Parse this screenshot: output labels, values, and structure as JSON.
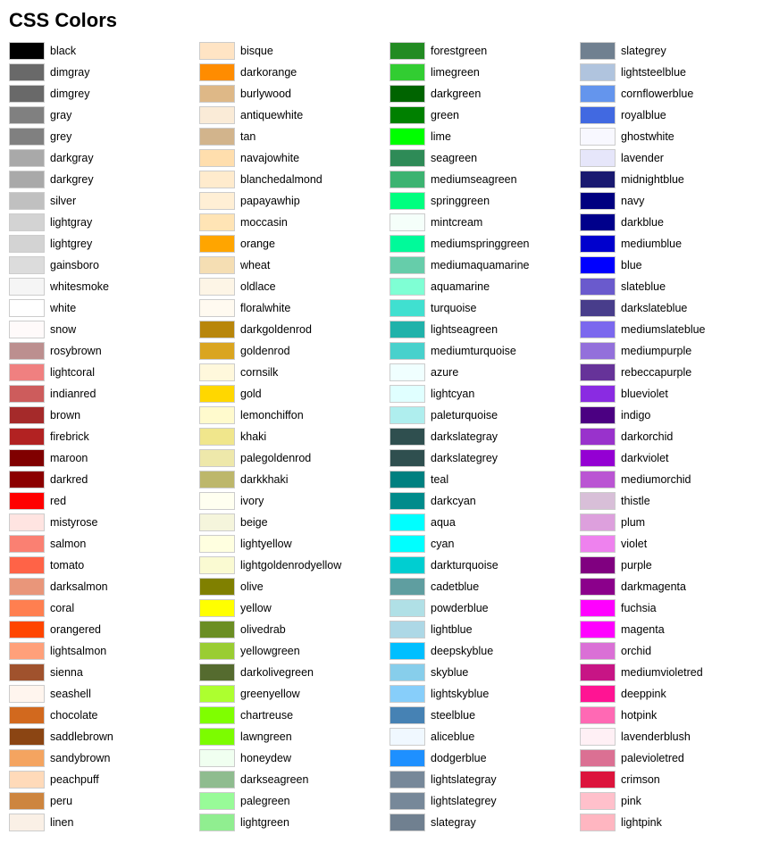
{
  "title": "CSS Colors",
  "columns": [
    [
      {
        "name": "black",
        "color": "#000000"
      },
      {
        "name": "dimgray",
        "color": "#696969"
      },
      {
        "name": "dimgrey",
        "color": "#696969"
      },
      {
        "name": "gray",
        "color": "#808080"
      },
      {
        "name": "grey",
        "color": "#808080"
      },
      {
        "name": "darkgray",
        "color": "#a9a9a9"
      },
      {
        "name": "darkgrey",
        "color": "#a9a9a9"
      },
      {
        "name": "silver",
        "color": "#c0c0c0"
      },
      {
        "name": "lightgray",
        "color": "#d3d3d3"
      },
      {
        "name": "lightgrey",
        "color": "#d3d3d3"
      },
      {
        "name": "gainsboro",
        "color": "#dcdcdc"
      },
      {
        "name": "whitesmoke",
        "color": "#f5f5f5"
      },
      {
        "name": "white",
        "color": "#ffffff"
      },
      {
        "name": "snow",
        "color": "#fffafa"
      },
      {
        "name": "rosybrown",
        "color": "#bc8f8f"
      },
      {
        "name": "lightcoral",
        "color": "#f08080"
      },
      {
        "name": "indianred",
        "color": "#cd5c5c"
      },
      {
        "name": "brown",
        "color": "#a52a2a"
      },
      {
        "name": "firebrick",
        "color": "#b22222"
      },
      {
        "name": "maroon",
        "color": "#800000"
      },
      {
        "name": "darkred",
        "color": "#8b0000"
      },
      {
        "name": "red",
        "color": "#ff0000"
      },
      {
        "name": "mistyrose",
        "color": "#ffe4e1"
      },
      {
        "name": "salmon",
        "color": "#fa8072"
      },
      {
        "name": "tomato",
        "color": "#ff6347"
      },
      {
        "name": "darksalmon",
        "color": "#e9967a"
      },
      {
        "name": "coral",
        "color": "#ff7f50"
      },
      {
        "name": "orangered",
        "color": "#ff4500"
      },
      {
        "name": "lightsalmon",
        "color": "#ffa07a"
      },
      {
        "name": "sienna",
        "color": "#a0522d"
      },
      {
        "name": "seashell",
        "color": "#fff5ee"
      },
      {
        "name": "chocolate",
        "color": "#d2691e"
      },
      {
        "name": "saddlebrown",
        "color": "#8b4513"
      },
      {
        "name": "sandybrown",
        "color": "#f4a460"
      },
      {
        "name": "peachpuff",
        "color": "#ffdab9"
      },
      {
        "name": "peru",
        "color": "#cd853f"
      },
      {
        "name": "linen",
        "color": "#faf0e6"
      }
    ],
    [
      {
        "name": "bisque",
        "color": "#ffe4c4"
      },
      {
        "name": "darkorange",
        "color": "#ff8c00"
      },
      {
        "name": "burlywood",
        "color": "#deb887"
      },
      {
        "name": "antiquewhite",
        "color": "#faebd7"
      },
      {
        "name": "tan",
        "color": "#d2b48c"
      },
      {
        "name": "navajowhite",
        "color": "#ffdead"
      },
      {
        "name": "blanchedalmond",
        "color": "#ffebcd"
      },
      {
        "name": "papayawhip",
        "color": "#ffefd5"
      },
      {
        "name": "moccasin",
        "color": "#ffe4b5"
      },
      {
        "name": "orange",
        "color": "#ffa500"
      },
      {
        "name": "wheat",
        "color": "#f5deb3"
      },
      {
        "name": "oldlace",
        "color": "#fdf5e6"
      },
      {
        "name": "floralwhite",
        "color": "#fffaf0"
      },
      {
        "name": "darkgoldenrod",
        "color": "#b8860b"
      },
      {
        "name": "goldenrod",
        "color": "#daa520"
      },
      {
        "name": "cornsilk",
        "color": "#fff8dc"
      },
      {
        "name": "gold",
        "color": "#ffd700"
      },
      {
        "name": "lemonchiffon",
        "color": "#fffacd"
      },
      {
        "name": "khaki",
        "color": "#f0e68c"
      },
      {
        "name": "palegoldenrod",
        "color": "#eee8aa"
      },
      {
        "name": "darkkhaki",
        "color": "#bdb76b"
      },
      {
        "name": "ivory",
        "color": "#fffff0"
      },
      {
        "name": "beige",
        "color": "#f5f5dc"
      },
      {
        "name": "lightyellow",
        "color": "#ffffe0"
      },
      {
        "name": "lightgoldenrodyellow",
        "color": "#fafad2"
      },
      {
        "name": "olive",
        "color": "#808000"
      },
      {
        "name": "yellow",
        "color": "#ffff00"
      },
      {
        "name": "olivedrab",
        "color": "#6b8e23"
      },
      {
        "name": "yellowgreen",
        "color": "#9acd32"
      },
      {
        "name": "darkolivegreen",
        "color": "#556b2f"
      },
      {
        "name": "greenyellow",
        "color": "#adff2f"
      },
      {
        "name": "chartreuse",
        "color": "#7fff00"
      },
      {
        "name": "lawngreen",
        "color": "#7cfc00"
      },
      {
        "name": "honeydew",
        "color": "#f0fff0"
      },
      {
        "name": "darkseagreen",
        "color": "#8fbc8f"
      },
      {
        "name": "palegreen",
        "color": "#98fb98"
      },
      {
        "name": "lightgreen",
        "color": "#90ee90"
      }
    ],
    [
      {
        "name": "forestgreen",
        "color": "#228b22"
      },
      {
        "name": "limegreen",
        "color": "#32cd32"
      },
      {
        "name": "darkgreen",
        "color": "#006400"
      },
      {
        "name": "green",
        "color": "#008000"
      },
      {
        "name": "lime",
        "color": "#00ff00"
      },
      {
        "name": "seagreen",
        "color": "#2e8b57"
      },
      {
        "name": "mediumseagreen",
        "color": "#3cb371"
      },
      {
        "name": "springgreen",
        "color": "#00ff7f"
      },
      {
        "name": "mintcream",
        "color": "#f5fffa"
      },
      {
        "name": "mediumspringgreen",
        "color": "#00fa9a"
      },
      {
        "name": "mediumaquamarine",
        "color": "#66cdaa"
      },
      {
        "name": "aquamarine",
        "color": "#7fffd4"
      },
      {
        "name": "turquoise",
        "color": "#40e0d0"
      },
      {
        "name": "lightseagreen",
        "color": "#20b2aa"
      },
      {
        "name": "mediumturquoise",
        "color": "#48d1cc"
      },
      {
        "name": "azure",
        "color": "#f0ffff"
      },
      {
        "name": "lightcyan",
        "color": "#e0ffff"
      },
      {
        "name": "paleturquoise",
        "color": "#afeeee"
      },
      {
        "name": "darkslategray",
        "color": "#2f4f4f"
      },
      {
        "name": "darkslategrey",
        "color": "#2f4f4f"
      },
      {
        "name": "teal",
        "color": "#008080"
      },
      {
        "name": "darkcyan",
        "color": "#008b8b"
      },
      {
        "name": "aqua",
        "color": "#00ffff"
      },
      {
        "name": "cyan",
        "color": "#00ffff"
      },
      {
        "name": "darkturquoise",
        "color": "#00ced1"
      },
      {
        "name": "cadetblue",
        "color": "#5f9ea0"
      },
      {
        "name": "powderblue",
        "color": "#b0e0e6"
      },
      {
        "name": "lightblue",
        "color": "#add8e6"
      },
      {
        "name": "deepskyblue",
        "color": "#00bfff"
      },
      {
        "name": "skyblue",
        "color": "#87ceeb"
      },
      {
        "name": "lightskyblue",
        "color": "#87cefa"
      },
      {
        "name": "steelblue",
        "color": "#4682b4"
      },
      {
        "name": "aliceblue",
        "color": "#f0f8ff"
      },
      {
        "name": "dodgerblue",
        "color": "#1e90ff"
      },
      {
        "name": "lightslategray",
        "color": "#778899"
      },
      {
        "name": "lightslategrey",
        "color": "#778899"
      },
      {
        "name": "slategray",
        "color": "#708090"
      }
    ],
    [
      {
        "name": "slategrey",
        "color": "#708090"
      },
      {
        "name": "lightsteelblue",
        "color": "#b0c4de"
      },
      {
        "name": "cornflowerblue",
        "color": "#6495ed"
      },
      {
        "name": "royalblue",
        "color": "#4169e1"
      },
      {
        "name": "ghostwhite",
        "color": "#f8f8ff"
      },
      {
        "name": "lavender",
        "color": "#e6e6fa"
      },
      {
        "name": "midnightblue",
        "color": "#191970"
      },
      {
        "name": "navy",
        "color": "#000080"
      },
      {
        "name": "darkblue",
        "color": "#00008b"
      },
      {
        "name": "mediumblue",
        "color": "#0000cd"
      },
      {
        "name": "blue",
        "color": "#0000ff"
      },
      {
        "name": "slateblue",
        "color": "#6a5acd"
      },
      {
        "name": "darkslateblue",
        "color": "#483d8b"
      },
      {
        "name": "mediumslateblue",
        "color": "#7b68ee"
      },
      {
        "name": "mediumpurple",
        "color": "#9370db"
      },
      {
        "name": "rebeccapurple",
        "color": "#663399"
      },
      {
        "name": "blueviolet",
        "color": "#8a2be2"
      },
      {
        "name": "indigo",
        "color": "#4b0082"
      },
      {
        "name": "darkorchid",
        "color": "#9932cc"
      },
      {
        "name": "darkviolet",
        "color": "#9400d3"
      },
      {
        "name": "mediumorchid",
        "color": "#ba55d3"
      },
      {
        "name": "thistle",
        "color": "#d8bfd8"
      },
      {
        "name": "plum",
        "color": "#dda0dd"
      },
      {
        "name": "violet",
        "color": "#ee82ee"
      },
      {
        "name": "purple",
        "color": "#800080"
      },
      {
        "name": "darkmagenta",
        "color": "#8b008b"
      },
      {
        "name": "fuchsia",
        "color": "#ff00ff"
      },
      {
        "name": "magenta",
        "color": "#ff00ff"
      },
      {
        "name": "orchid",
        "color": "#da70d6"
      },
      {
        "name": "mediumvioletred",
        "color": "#c71585"
      },
      {
        "name": "deeppink",
        "color": "#ff1493"
      },
      {
        "name": "hotpink",
        "color": "#ff69b4"
      },
      {
        "name": "lavenderblush",
        "color": "#fff0f5"
      },
      {
        "name": "palevioletred",
        "color": "#db7093"
      },
      {
        "name": "crimson",
        "color": "#dc143c"
      },
      {
        "name": "pink",
        "color": "#ffc0cb"
      },
      {
        "name": "lightpink",
        "color": "#ffb6c1"
      }
    ]
  ]
}
